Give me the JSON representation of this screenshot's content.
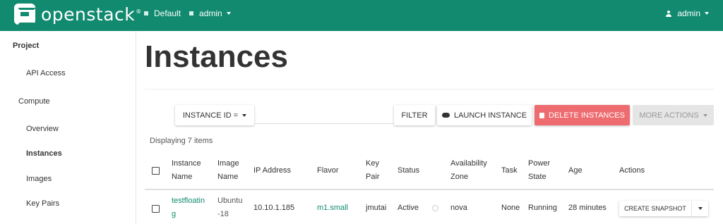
{
  "brand": {
    "name": "openstack",
    "tm": "®"
  },
  "topnav": {
    "domain": "Default",
    "project": "admin"
  },
  "user": {
    "name": "admin"
  },
  "sidebar": {
    "items": [
      {
        "label": "Project"
      },
      {
        "label": "API Access"
      },
      {
        "label": "Compute"
      },
      {
        "label": "Overview"
      },
      {
        "label": "Instances"
      },
      {
        "label": "Images"
      },
      {
        "label": "Key Pairs"
      }
    ]
  },
  "page": {
    "title": "Instances"
  },
  "toolbar": {
    "filter_type": "INSTANCE ID =",
    "filter_value": "",
    "filter_button": "FILTER",
    "launch_button": "LAUNCH INSTANCE",
    "delete_button": "DELETE INSTANCES",
    "more_actions": "MORE ACTIONS"
  },
  "table": {
    "count_text": "Displaying 7 items",
    "headers": {
      "instance_name": [
        "Instance",
        "Name"
      ],
      "image_name": [
        "Image",
        "Name"
      ],
      "ip_address": "IP Address",
      "flavor": "Flavor",
      "key_pair": [
        "Key",
        "Pair"
      ],
      "status": "Status",
      "availability_zone": [
        "Availability",
        "Zone"
      ],
      "task": "Task",
      "power_state": [
        "Power",
        "State"
      ],
      "age": "Age",
      "actions": "Actions"
    },
    "rows": [
      {
        "instance_name": [
          "testfloatin",
          "g"
        ],
        "image_name": [
          "Ubuntu",
          "-18"
        ],
        "ip_address": "10.10.1.185",
        "flavor": "m1.small",
        "key_pair": "jmutai",
        "status": "Active",
        "availability_zone": "nova",
        "task": "None",
        "power_state": "Running",
        "age": "28 minutes",
        "action": "CREATE SNAPSHOT"
      }
    ]
  },
  "colors": {
    "brand": "#118a6f",
    "danger": "#ee6b6f",
    "disabled": "#e5e5e5"
  }
}
